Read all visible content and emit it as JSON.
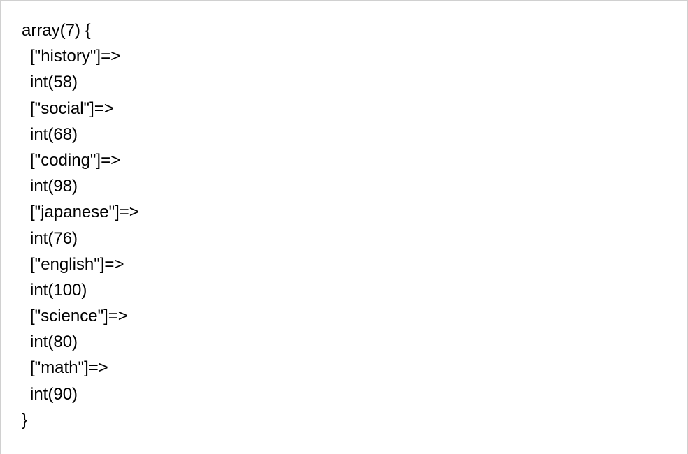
{
  "output": {
    "header": "array(7) {",
    "footer": "}",
    "entries": [
      {
        "key": "[\"history\"]=>",
        "val": "int(58)"
      },
      {
        "key": "[\"social\"]=>",
        "val": "int(68)"
      },
      {
        "key": "[\"coding\"]=>",
        "val": "int(98)"
      },
      {
        "key": "[\"japanese\"]=>",
        "val": "int(76)"
      },
      {
        "key": "[\"english\"]=>",
        "val": "int(100)"
      },
      {
        "key": "[\"science\"]=>",
        "val": "int(80)"
      },
      {
        "key": "[\"math\"]=>",
        "val": "int(90)"
      }
    ]
  }
}
